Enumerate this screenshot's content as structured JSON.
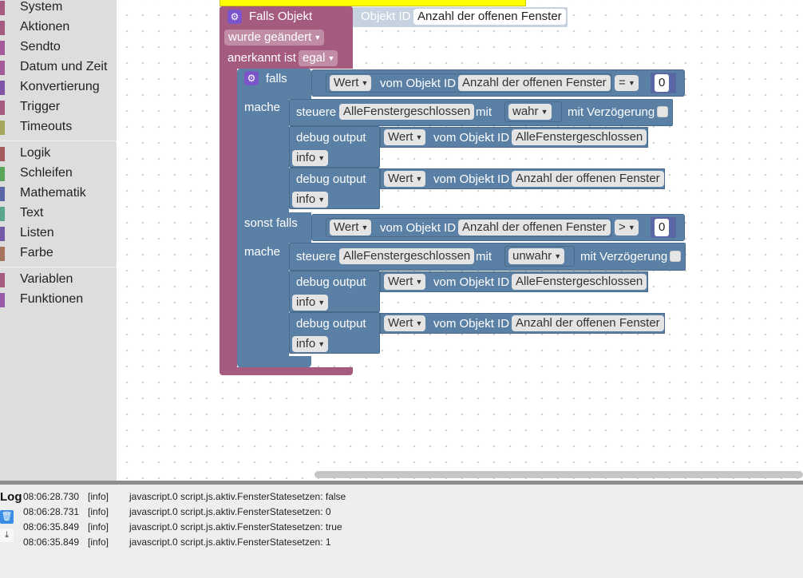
{
  "toolbox": {
    "categories": [
      {
        "label": "System",
        "color": "#a55b80"
      },
      {
        "label": "Aktionen",
        "color": "#a55b80"
      },
      {
        "label": "Sendto",
        "color": "#a55b99"
      },
      {
        "label": "Datum und Zeit",
        "color": "#a55b99"
      },
      {
        "label": "Konvertierung",
        "color": "#8055a5"
      },
      {
        "label": "Trigger",
        "color": "#a55b80"
      },
      {
        "label": "Timeouts",
        "color": "#a5a55b"
      },
      {
        "label": "Logik",
        "color": "#a55b5b"
      },
      {
        "label": "Schleifen",
        "color": "#5ba55b"
      },
      {
        "label": "Mathematik",
        "color": "#5b67a5"
      },
      {
        "label": "Text",
        "color": "#5ba58c"
      },
      {
        "label": "Listen",
        "color": "#745ba5"
      },
      {
        "label": "Farbe",
        "color": "#a5745b"
      },
      {
        "label": "Variablen",
        "color": "#a55b80"
      },
      {
        "label": "Funktionen",
        "color": "#995ba5"
      }
    ]
  },
  "trigger": {
    "title": "Falls Objekt",
    "objekt_id_label": "Objekt ID",
    "objekt_id_value": "Anzahl der offenen Fenster",
    "change_dropdown": "wurde geändert",
    "ack_label": "anerkannt ist",
    "ack_dropdown": "egal"
  },
  "ifblock": {
    "falls": "falls",
    "mache": "mache",
    "sonst_falls": "sonst falls",
    "cond1": {
      "wert": "Wert",
      "vom": "vom Objekt ID",
      "id": "Anzahl der offenen Fenster",
      "op": "=",
      "num": "0"
    },
    "cond2": {
      "wert": "Wert",
      "vom": "vom Objekt ID",
      "id": "Anzahl der offenen Fenster",
      "op": ">",
      "num": "0"
    },
    "branch1": {
      "steuere": "steuere",
      "target": "AlleFenstergeschlossen",
      "mit": "mit",
      "value": "wahr",
      "delay": "mit Verzögerung",
      "debug1": {
        "label": "debug output",
        "wert": "Wert",
        "vom": "vom Objekt ID",
        "id": "AlleFenstergeschlossen",
        "level": "info"
      },
      "debug2": {
        "label": "debug output",
        "wert": "Wert",
        "vom": "vom Objekt ID",
        "id": "Anzahl der offenen Fenster",
        "level": "info"
      }
    },
    "branch2": {
      "steuere": "steuere",
      "target": "AlleFenstergeschlossen",
      "mit": "mit",
      "value": "unwahr",
      "delay": "mit Verzögerung",
      "debug1": {
        "label": "debug output",
        "wert": "Wert",
        "vom": "vom Objekt ID",
        "id": "AlleFenstergeschlossen",
        "level": "info"
      },
      "debug2": {
        "label": "debug output",
        "wert": "Wert",
        "vom": "vom Objekt ID",
        "id": "Anzahl der offenen Fenster",
        "level": "info"
      }
    }
  },
  "log": {
    "title": "Log",
    "rows": [
      {
        "time": "08:06:28.730",
        "level": "[info]",
        "msg": "javascript.0 script.js.aktiv.FensterStatesetzen: false"
      },
      {
        "time": "08:06:28.731",
        "level": "[info]",
        "msg": "javascript.0 script.js.aktiv.FensterStatesetzen: 0"
      },
      {
        "time": "08:06:35.849",
        "level": "[info]",
        "msg": "javascript.0 script.js.aktiv.FensterStatesetzen: true"
      },
      {
        "time": "08:06:35.849",
        "level": "[info]",
        "msg": "javascript.0 script.js.aktiv.FensterStatesetzen: 1"
      }
    ]
  }
}
